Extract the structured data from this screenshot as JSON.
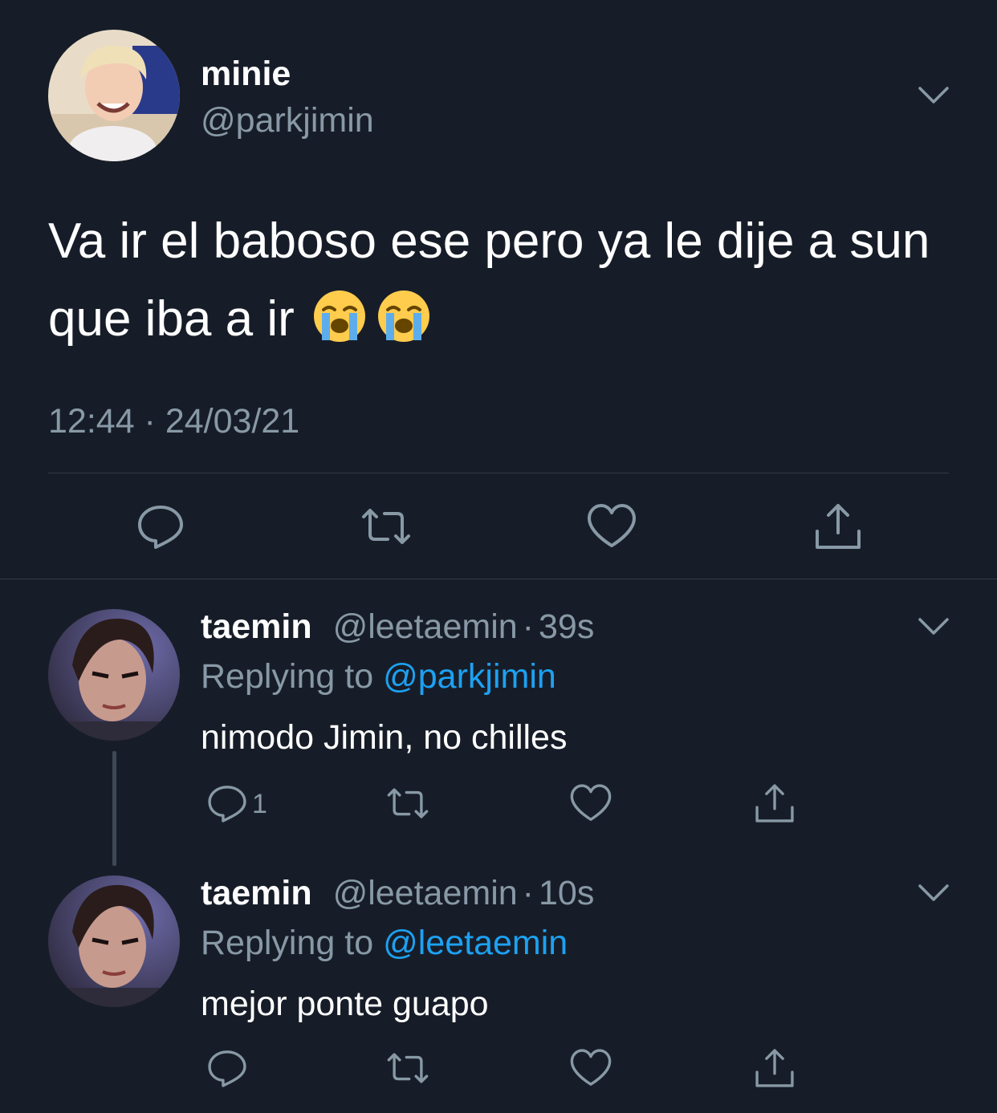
{
  "main_tweet": {
    "display_name": "minie",
    "handle": "@parkjimin",
    "text": "Va ir el baboso ese pero ya le dije a sun que iba a ir",
    "emojis": [
      "loudly-crying-face-icon",
      "loudly-crying-face-icon"
    ],
    "timestamp": "12:44 · 24/03/21",
    "actions": [
      "reply-icon",
      "retweet-icon",
      "like-icon",
      "share-icon"
    ]
  },
  "replies": [
    {
      "display_name": "taemin",
      "handle": "@leetaemin",
      "separator": "·",
      "time": "39s",
      "replying_prefix": "Replying to",
      "replying_to": "@parkjimin",
      "text": "nimodo Jimin, no chilles",
      "reply_count": "1"
    },
    {
      "display_name": "taemin",
      "handle": "@leetaemin",
      "separator": "·",
      "time": "10s",
      "replying_prefix": "Replying to",
      "replying_to": "@leetaemin",
      "text": "mejor ponte guapo",
      "reply_count": ""
    }
  ],
  "colors": {
    "background": "#171d28",
    "secondary_text": "#8899a6",
    "link": "#1da1f2",
    "divider": "#2f3b47"
  }
}
